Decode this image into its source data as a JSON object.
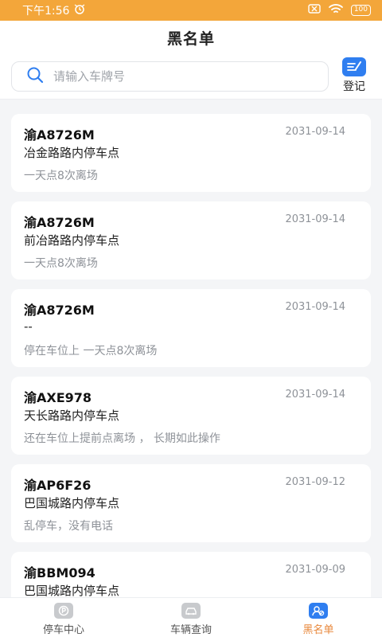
{
  "status_bar": {
    "time": "下午1:56",
    "battery": "100"
  },
  "header": {
    "title": "黑名单"
  },
  "search": {
    "placeholder": "请输入车牌号",
    "value": ""
  },
  "register": {
    "label": "登记"
  },
  "records": [
    {
      "plate": "渝A8726M",
      "date": "2031-09-14",
      "location": "冶金路路内停车点",
      "note": "一天点8次离场"
    },
    {
      "plate": "渝A8726M",
      "date": "2031-09-14",
      "location": "前冶路路内停车点",
      "note": "一天点8次离场"
    },
    {
      "plate": "渝A8726M",
      "date": "2031-09-14",
      "location": "--",
      "note": "停在车位上 一天点8次离场"
    },
    {
      "plate": "渝AXE978",
      "date": "2031-09-14",
      "location": "天长路路内停车点",
      "note": "还在车位上提前点离场 ， 长期如此操作"
    },
    {
      "plate": "渝AP6F26",
      "date": "2031-09-12",
      "location": "巴国城路内停车点",
      "note": "乱停车，没有电话"
    },
    {
      "plate": "渝BBM094",
      "date": "2031-09-09",
      "location": "巴国城路内停车点",
      "note": ""
    }
  ],
  "tabs": [
    {
      "label": "停车中心",
      "icon": "parking-icon",
      "active": false
    },
    {
      "label": "车辆查询",
      "icon": "car-icon",
      "active": false
    },
    {
      "label": "黑名单",
      "icon": "blacklist-icon",
      "active": true
    }
  ],
  "colors": {
    "status_bar": "#f3a63a",
    "accent_blue": "#2f7ef0",
    "active_tab": "#e8873a"
  }
}
